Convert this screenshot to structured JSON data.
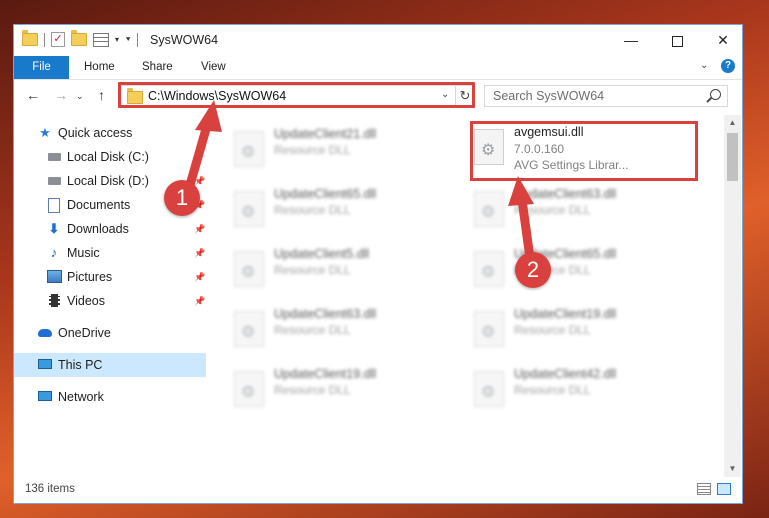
{
  "window": {
    "title": "SysWOW64",
    "min_label": "—",
    "close_label": "✕"
  },
  "ribbon": {
    "tabs": [
      "File",
      "Home",
      "Share",
      "View"
    ],
    "help_label": "?"
  },
  "nav": {
    "address": "C:\\Windows\\SysWOW64",
    "search_placeholder": "Search SysWOW64"
  },
  "sidebar": {
    "items": [
      {
        "label": "Quick access",
        "icon": "star-icon",
        "pinned": false
      },
      {
        "label": "Local Disk (C:)",
        "icon": "disk-icon",
        "pinned": false
      },
      {
        "label": "Local Disk (D:)",
        "icon": "disk-icon",
        "pinned": true
      },
      {
        "label": "Documents",
        "icon": "documents-icon",
        "pinned": true
      },
      {
        "label": "Downloads",
        "icon": "downloads-icon",
        "pinned": true
      },
      {
        "label": "Music",
        "icon": "music-icon",
        "pinned": true
      },
      {
        "label": "Pictures",
        "icon": "pictures-icon",
        "pinned": true
      },
      {
        "label": "Videos",
        "icon": "videos-icon",
        "pinned": true
      },
      {
        "label": "OneDrive",
        "icon": "onedrive-icon",
        "pinned": false
      },
      {
        "label": "This PC",
        "icon": "this-pc-icon",
        "pinned": false,
        "selected": true
      },
      {
        "label": "Network",
        "icon": "network-icon",
        "pinned": false
      }
    ]
  },
  "files": {
    "highlighted": {
      "name": "avgemsui.dll",
      "version": "7.0.0.160",
      "description": "AVG Settings Librar..."
    },
    "left_column": [
      {
        "name": "UpdateClient21.dll",
        "type": "Resource DLL"
      },
      {
        "name": "UpdateClient65.dll",
        "type": "Resource DLL"
      },
      {
        "name": "UpdateClient5.dll",
        "type": "Resource DLL"
      },
      {
        "name": "UpdateClient63.dll",
        "type": "Resource DLL"
      },
      {
        "name": "UpdateClient19.dll",
        "type": "Resource DLL"
      }
    ],
    "right_column": [
      {
        "name": "UpdateClient63.dll",
        "type": "Resource DLL"
      },
      {
        "name": "UpdateClient65.dll",
        "type": "Resource DLL"
      },
      {
        "name": "UpdateClient19.dll",
        "type": "Resource DLL"
      },
      {
        "name": "UpdateClient42.dll",
        "type": "Resource DLL"
      }
    ]
  },
  "status": {
    "item_count": "136 items"
  },
  "annotations": {
    "badge1": "1",
    "badge2": "2",
    "color": "#d9413f"
  }
}
